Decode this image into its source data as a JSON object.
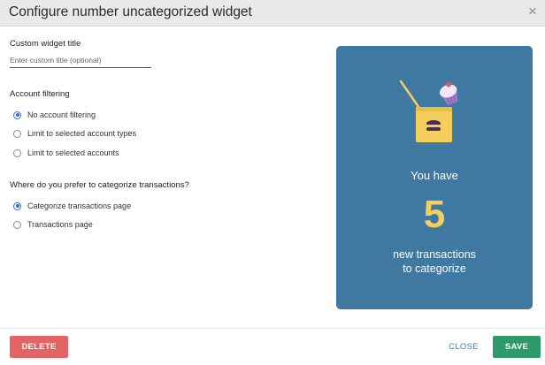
{
  "dialog": {
    "title": "Configure number uncategorized widget",
    "close_glyph": "×"
  },
  "custom_title": {
    "label": "Custom widget title",
    "placeholder": "Enter custom title (optional)",
    "value": ""
  },
  "account_filtering": {
    "label": "Account filtering",
    "options": [
      {
        "label": "No account filtering",
        "checked": true
      },
      {
        "label": "Limit to selected account types",
        "checked": false
      },
      {
        "label": "Limit to selected accounts",
        "checked": false
      }
    ]
  },
  "categorize_location": {
    "label": "Where do you prefer to categorize transactions?",
    "options": [
      {
        "label": "Categorize transactions page",
        "checked": true
      },
      {
        "label": "Transactions page",
        "checked": false
      }
    ]
  },
  "promo": {
    "you_have": "You have",
    "count": "5",
    "line1": "new transactions",
    "line2": "to categorize",
    "background_color": "#3f78a0",
    "count_color": "#f5cf5b",
    "illustration": "box-with-flag-and-cupcake-icon"
  },
  "footer": {
    "delete_label": "DELETE",
    "close_label": "CLOSE",
    "save_label": "SAVE",
    "delete_color": "#e26464",
    "save_color": "#2e9a6a"
  }
}
